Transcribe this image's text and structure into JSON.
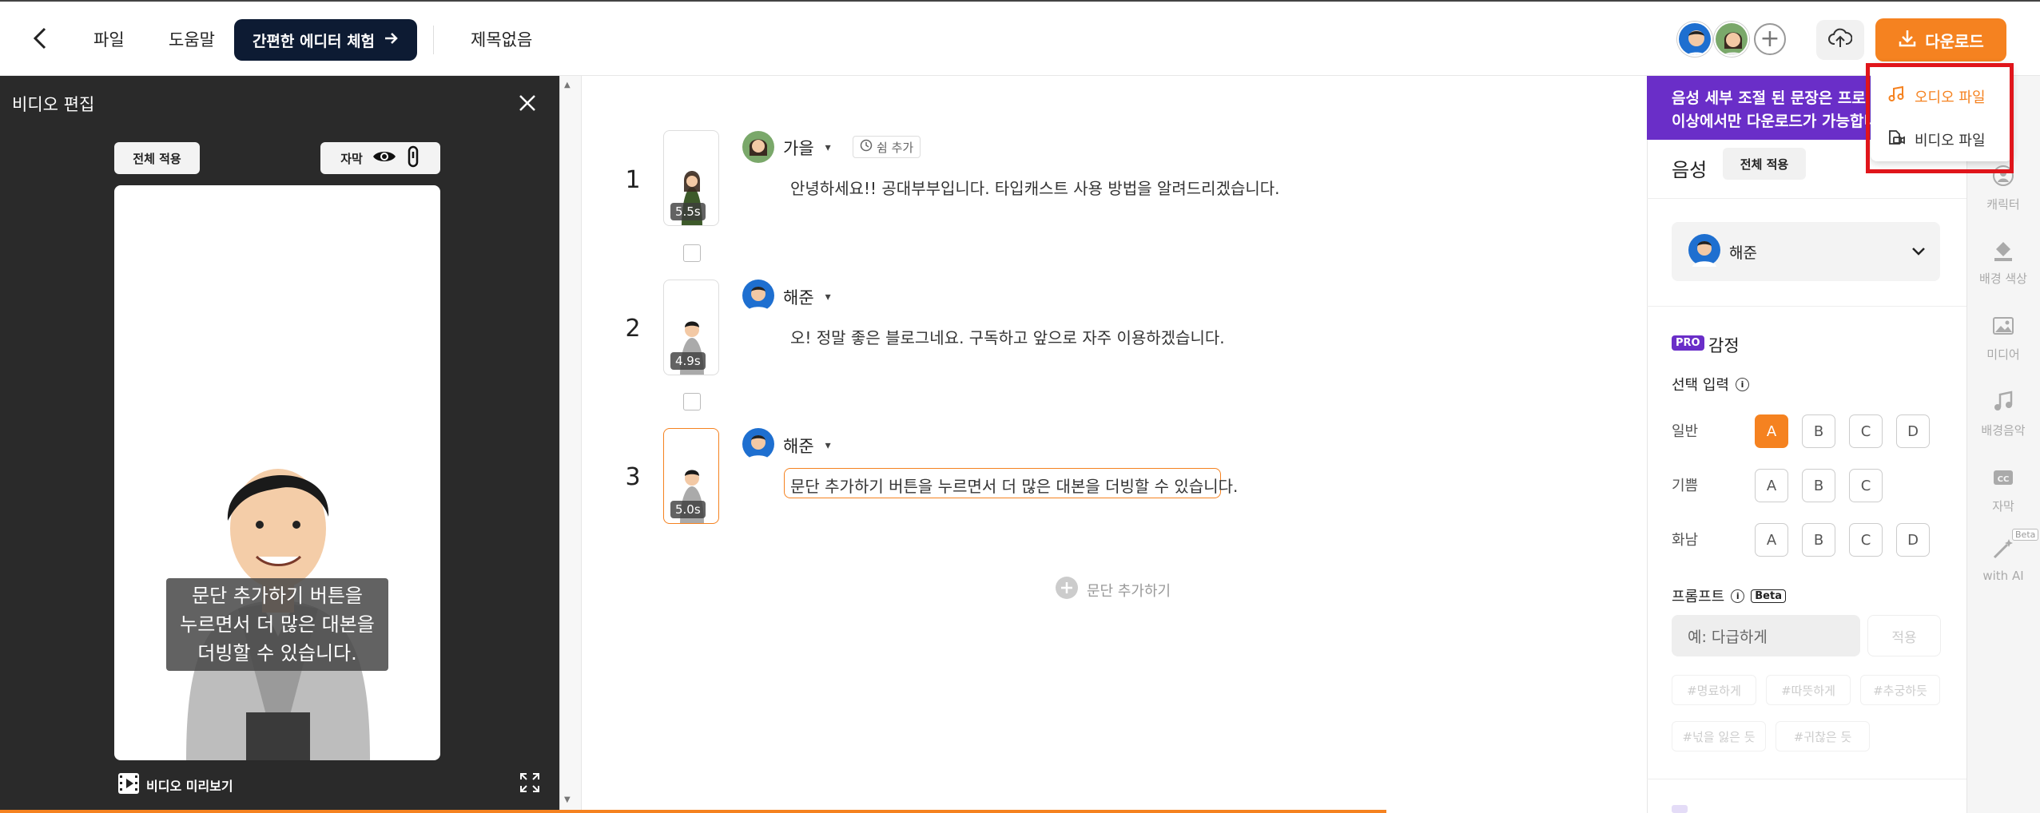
{
  "topbar": {
    "back_icon": "chevron-left-icon",
    "menu_file": "파일",
    "menu_help": "도움말",
    "cta_label": "간편한 에디터 체험",
    "doc_title": "제목없음",
    "download_label": "다운로드",
    "accent_color": "#f58220"
  },
  "download_menu": {
    "items": [
      {
        "label": "오디오 파일",
        "icon": "music-file-icon",
        "color": "#f58220"
      },
      {
        "label": "비디오 파일",
        "icon": "video-file-icon",
        "color": "#333333"
      }
    ]
  },
  "video_panel": {
    "title": "비디오 편집",
    "apply_all": "전체 적용",
    "subtitle_label": "자막",
    "caption": "문단 추가하기 버튼을\n누르면서 더 많은 대본을\n더빙할 수 있습니다.",
    "preview_label": "비디오 미리보기"
  },
  "script": {
    "rows": [
      {
        "num": "1",
        "speaker": "가을",
        "duration": "5.5s",
        "text": "안녕하세요!! 공대부부입니다. 타입캐스트 사용 방법을 알려드리겠습니다."
      },
      {
        "num": "2",
        "speaker": "해준",
        "duration": "4.9s",
        "text": "오! 정말 좋은 블로그네요. 구독하고 앞으로 자주 이용하겠습니다."
      },
      {
        "num": "3",
        "speaker": "해준",
        "duration": "5.0s",
        "text": "문단 추가하기 버튼을 누르면서 더 많은 대본을 더빙할 수 있습니다."
      }
    ],
    "pause_add": "쉼 추가",
    "add_paragraph": "문단 추가하기"
  },
  "voice_panel": {
    "notice_line1": "음성 세부 조절 된 문장은 프로 플",
    "notice_line2": "이상에서만 다운로드가 가능합니",
    "notice_color": "#6a2ec8",
    "title": "음성",
    "apply_all": "전체 적용",
    "speaker": "해준",
    "pro_badge": "PRO",
    "emotion_title": "감정",
    "select_input": "선택 입력",
    "emotions": [
      {
        "label": "일반",
        "options": [
          "A",
          "B",
          "C",
          "D"
        ],
        "selected": "A"
      },
      {
        "label": "기쁨",
        "options": [
          "A",
          "B",
          "C"
        ],
        "selected": ""
      },
      {
        "label": "화남",
        "options": [
          "A",
          "B",
          "C",
          "D"
        ],
        "selected": ""
      }
    ],
    "prompt_label": "프롬프트",
    "beta": "Beta",
    "prompt_placeholder": "예: 다급하게",
    "prompt_apply": "적용",
    "chips": [
      "#명료하게",
      "#따뜻하게",
      "#추궁하듯",
      "#넋을 잃은 듯",
      "#귀찮은 듯"
    ]
  },
  "sidebar": {
    "items": [
      {
        "label": "캐릭터",
        "icon": "character-icon"
      },
      {
        "label": "배경 색상",
        "icon": "paint-bucket-icon"
      },
      {
        "label": "미디어",
        "icon": "image-icon"
      },
      {
        "label": "배경음악",
        "icon": "music-note-icon"
      },
      {
        "label": "자막",
        "icon": "cc-icon"
      },
      {
        "label": "with AI",
        "icon": "ai-wand-icon",
        "badge": "Beta"
      }
    ]
  }
}
